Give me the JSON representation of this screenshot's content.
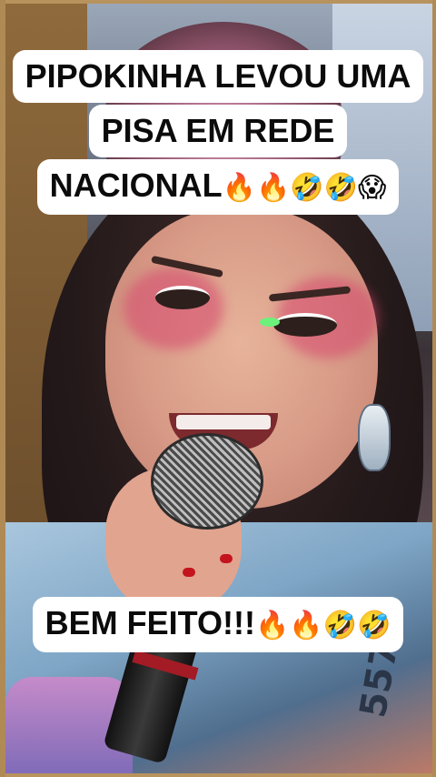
{
  "caption_top": {
    "line1": "PIPOKINHA LEVOU UMA",
    "line2": "PISA EM REDE",
    "line3": "NACIONAL",
    "line3_emojis": "🔥🔥🤣🤣😱"
  },
  "caption_bottom": {
    "text": "BEM FEITO!!!",
    "emojis": "🔥🔥🤣🤣"
  },
  "shirt_print": "557",
  "colors": {
    "frame": "#b08a55",
    "caption_bg": "#ffffff",
    "caption_text": "#0b0b0b"
  }
}
